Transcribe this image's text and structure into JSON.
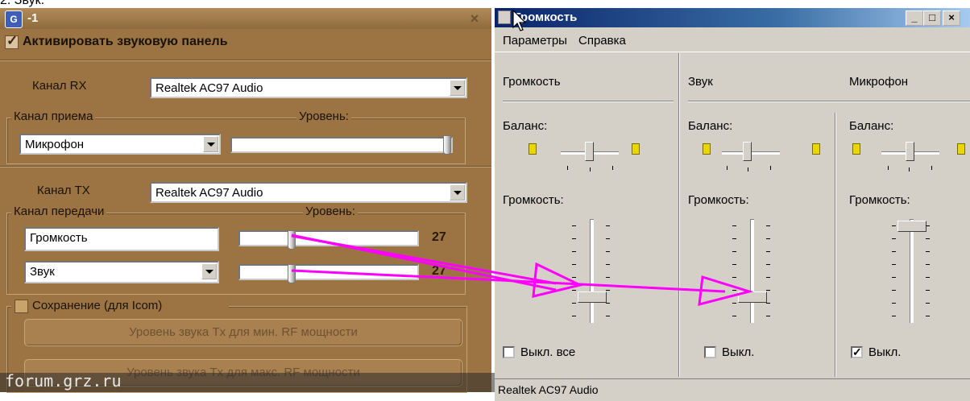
{
  "top_fragment": "2. Звук.",
  "left_window": {
    "title": "-1",
    "close_glyph": "×",
    "activate_label": "Активировать звуковую панель",
    "activate_checked": true,
    "rx_label": "Канал RX",
    "rx_value": "Realtek AC97 Audio",
    "receive_group": "Канал приема",
    "receive_level_label": "Уровень:",
    "receive_channel": "Микрофон",
    "receive_level": 1.0,
    "tx_label": "Канал TX",
    "tx_value": "Realtek AC97 Audio",
    "transmit_group": "Канал передачи",
    "transmit_level_label": "Уровень:",
    "transmit_rows": [
      {
        "channel": "Громкость",
        "value": "27",
        "level": 0.27
      },
      {
        "channel": "Звук",
        "value": "27",
        "level": 0.27
      }
    ],
    "save_label": "Сохранение (для Icom)",
    "save_checked": false,
    "btn_min": "Уровень звука Tx для мин. RF мощности",
    "btn_max": "Уровень звука Tx для макс. RF мощности"
  },
  "right_window": {
    "title": "Громкость",
    "menu": [
      "Параметры",
      "Справка"
    ],
    "columns": [
      {
        "header": "Громкость",
        "balance_label": "Баланс:",
        "volume_label": "Громкость:",
        "mute_label": "Выкл. все",
        "muted": false,
        "volume": 0.2
      },
      {
        "header": "Звук",
        "balance_label": "Баланс:",
        "volume_label": "Громкость:",
        "mute_label": "Выкл.",
        "muted": false,
        "volume": 0.2
      },
      {
        "header": "Микрофон",
        "balance_label": "Баланс:",
        "volume_label": "Громкость:",
        "mute_label": "Выкл.",
        "muted": true,
        "volume": 0.95
      }
    ],
    "status": "Realtek AC97 Audio"
  },
  "watermark": "forum.grz.ru",
  "annotation_color": "#ff00ff",
  "left_bg": "#9c7443"
}
